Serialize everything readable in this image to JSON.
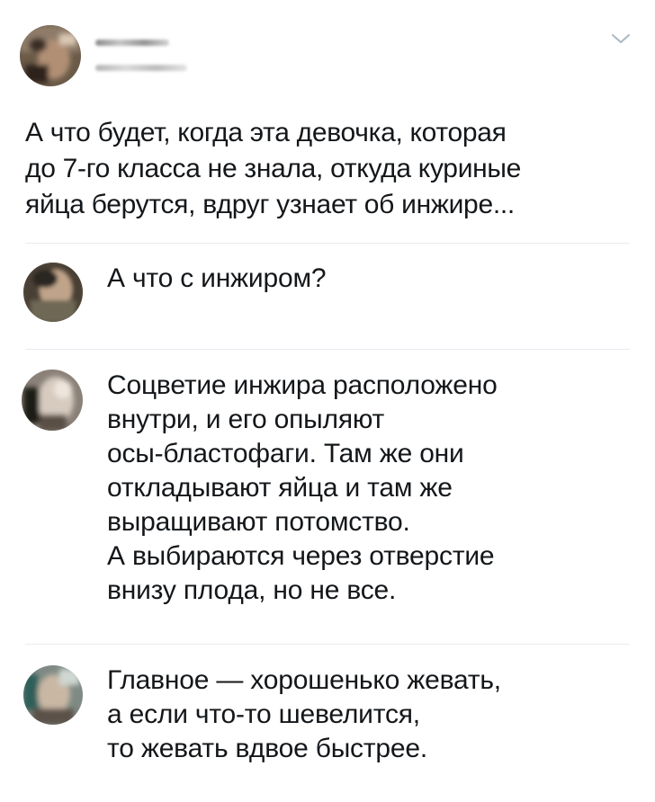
{
  "tweet": {
    "author": {
      "avatar_icon": "user-avatar-blurred",
      "name_blurred": true,
      "handle_blurred": true
    },
    "menu_icon": "chevron-down-icon",
    "text": "А что будет, когда эта девочка, которая\nдо 7-го класса не знала, откуда куриные\nяйца берутся, вдруг узнает об инжире..."
  },
  "replies": [
    {
      "avatar_icon": "user-avatar-blurred",
      "text": "А что с инжиром?"
    },
    {
      "avatar_icon": "user-avatar-blurred",
      "text": "Соцветие инжира расположено\nвнутри, и его опыляют\nосы-бластофаги. Там же они\nоткладывают яйца и там же\nвыращивают потомство.\nА выбираются через отверстие\nвнизу плода, но не все."
    },
    {
      "avatar_icon": "user-avatar-blurred",
      "text": "Главное — хорошенько жевать,\nа если что-то шевелится,\nто жевать вдвое быстрее."
    }
  ],
  "colors": {
    "text": "#14171a",
    "divider": "#e6ecf0",
    "chevron": "#aab8c2"
  }
}
